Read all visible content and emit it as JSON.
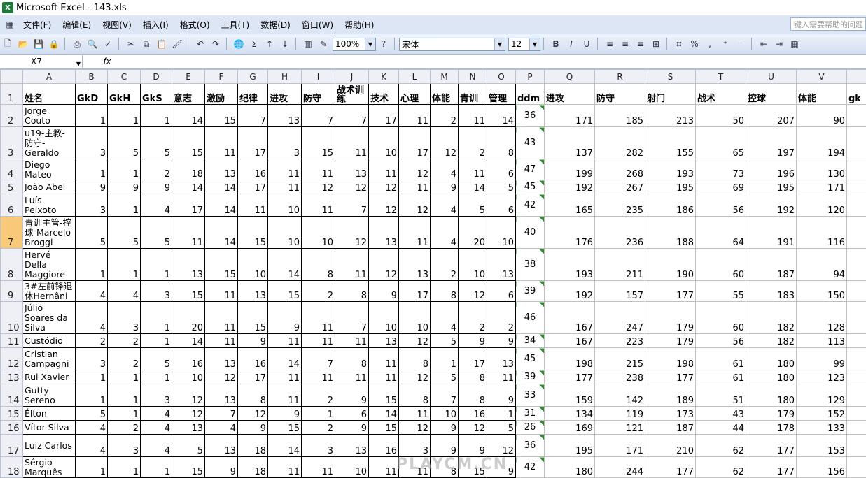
{
  "window": {
    "title": "Microsoft Excel - 143.xls",
    "logo": "X"
  },
  "menu": [
    "文件(F)",
    "编辑(E)",
    "视图(V)",
    "插入(I)",
    "格式(O)",
    "工具(T)",
    "数据(D)",
    "窗口(W)",
    "帮助(H)"
  ],
  "help_placeholder": "键入需要帮助的问题",
  "toolbar": {
    "zoom": "100%",
    "font": "宋体",
    "size": "12",
    "bold": "B",
    "italic": "I",
    "underline": "U"
  },
  "namebox": "X7",
  "fx": "fx",
  "columns": [
    "A",
    "B",
    "C",
    "D",
    "E",
    "F",
    "G",
    "H",
    "I",
    "J",
    "K",
    "L",
    "M",
    "N",
    "O",
    "P",
    "Q",
    "R",
    "S",
    "T",
    "U",
    "V"
  ],
  "headers": [
    "姓名",
    "GkD",
    "GkH",
    "GkS",
    "意志",
    "激励",
    "纪律",
    "进攻",
    "防守",
    "战术训练",
    "技术",
    "心理",
    "体能",
    "青训",
    "管理",
    "ddm",
    "进攻",
    "防守",
    "射门",
    "战术",
    "控球",
    "体能",
    "gk"
  ],
  "rows": [
    {
      "num": "1"
    },
    {
      "num": "2",
      "cells": [
        "Jorge Couto",
        "1",
        "1",
        "1",
        "14",
        "15",
        "7",
        "13",
        "7",
        "7",
        "17",
        "11",
        "2",
        "11",
        "14",
        "36",
        "171",
        "185",
        "213",
        "50",
        "207",
        "90"
      ]
    },
    {
      "num": "3",
      "cells": [
        "u19-主教-防守-Geraldo",
        "3",
        "5",
        "5",
        "15",
        "11",
        "17",
        "3",
        "15",
        "11",
        "10",
        "17",
        "12",
        "2",
        "8",
        "43",
        "137",
        "282",
        "155",
        "65",
        "197",
        "194"
      ]
    },
    {
      "num": "4",
      "cells": [
        "Diego Mateo",
        "1",
        "1",
        "2",
        "18",
        "13",
        "16",
        "11",
        "11",
        "13",
        "11",
        "12",
        "4",
        "11",
        "6",
        "47",
        "199",
        "268",
        "193",
        "73",
        "196",
        "130"
      ]
    },
    {
      "num": "5",
      "cells": [
        "João Abel",
        "9",
        "9",
        "9",
        "14",
        "14",
        "17",
        "11",
        "12",
        "12",
        "12",
        "11",
        "9",
        "14",
        "5",
        "45",
        "192",
        "267",
        "195",
        "69",
        "195",
        "171"
      ]
    },
    {
      "num": "6",
      "cells": [
        "Luís Peixoto",
        "3",
        "1",
        "4",
        "17",
        "14",
        "11",
        "10",
        "11",
        "7",
        "12",
        "12",
        "4",
        "5",
        "6",
        "42",
        "165",
        "235",
        "186",
        "56",
        "192",
        "120"
      ]
    },
    {
      "num": "7",
      "cells": [
        "青训主管-控球-Marcelo Broggi",
        "5",
        "5",
        "5",
        "11",
        "14",
        "15",
        "10",
        "10",
        "12",
        "13",
        "11",
        "4",
        "20",
        "10",
        "40",
        "176",
        "236",
        "188",
        "64",
        "191",
        "116"
      ]
    },
    {
      "num": "8",
      "cells": [
        "Hervé Della Maggiore",
        "1",
        "1",
        "1",
        "13",
        "15",
        "10",
        "14",
        "8",
        "11",
        "12",
        "13",
        "2",
        "10",
        "13",
        "38",
        "193",
        "211",
        "190",
        "60",
        "187",
        "94"
      ]
    },
    {
      "num": "9",
      "cells": [
        "3#左前锋退休Hernâni",
        "4",
        "4",
        "3",
        "15",
        "11",
        "13",
        "15",
        "2",
        "8",
        "9",
        "17",
        "8",
        "12",
        "6",
        "39",
        "192",
        "157",
        "177",
        "55",
        "183",
        "150"
      ]
    },
    {
      "num": "10",
      "cells": [
        "Júlio Soares da Silva",
        "4",
        "3",
        "1",
        "20",
        "11",
        "15",
        "9",
        "11",
        "7",
        "10",
        "10",
        "4",
        "2",
        "2",
        "46",
        "167",
        "247",
        "179",
        "60",
        "182",
        "128"
      ]
    },
    {
      "num": "11",
      "cells": [
        "Custódio",
        "2",
        "2",
        "1",
        "14",
        "11",
        "9",
        "11",
        "11",
        "11",
        "13",
        "12",
        "5",
        "9",
        "9",
        "34",
        "167",
        "223",
        "179",
        "56",
        "182",
        "113"
      ]
    },
    {
      "num": "12",
      "cells": [
        "Cristian Campagni",
        "3",
        "2",
        "5",
        "16",
        "13",
        "16",
        "14",
        "7",
        "8",
        "11",
        "8",
        "1",
        "17",
        "13",
        "45",
        "198",
        "215",
        "198",
        "61",
        "180",
        "99"
      ]
    },
    {
      "num": "13",
      "cells": [
        "Rui Xavier",
        "1",
        "1",
        "1",
        "10",
        "12",
        "17",
        "11",
        "11",
        "11",
        "11",
        "12",
        "5",
        "8",
        "11",
        "39",
        "177",
        "238",
        "177",
        "61",
        "180",
        "123"
      ]
    },
    {
      "num": "14",
      "cells": [
        "Gutty Sereno",
        "1",
        "1",
        "3",
        "12",
        "13",
        "8",
        "11",
        "2",
        "9",
        "15",
        "8",
        "7",
        "8",
        "9",
        "33",
        "159",
        "142",
        "189",
        "51",
        "180",
        "129"
      ]
    },
    {
      "num": "15",
      "cells": [
        "Élton",
        "5",
        "1",
        "4",
        "12",
        "7",
        "12",
        "9",
        "1",
        "6",
        "14",
        "11",
        "10",
        "16",
        "1",
        "31",
        "134",
        "119",
        "173",
        "43",
        "179",
        "152"
      ]
    },
    {
      "num": "16",
      "cells": [
        "Vítor Silva",
        "4",
        "2",
        "4",
        "13",
        "4",
        "9",
        "15",
        "2",
        "9",
        "15",
        "12",
        "9",
        "12",
        "5",
        "26",
        "169",
        "121",
        "187",
        "44",
        "178",
        "133"
      ]
    },
    {
      "num": "17",
      "cells": [
        "Luiz Carlos",
        "4",
        "3",
        "4",
        "5",
        "13",
        "18",
        "14",
        "3",
        "13",
        "16",
        "3",
        "9",
        "9",
        "12",
        "36",
        "195",
        "171",
        "210",
        "62",
        "177",
        "153"
      ]
    },
    {
      "num": "18",
      "cells": [
        "Sérgio Marquês",
        "1",
        "1",
        "1",
        "15",
        "9",
        "18",
        "11",
        "11",
        "10",
        "11",
        "11",
        "8",
        "15",
        "9",
        "42",
        "180",
        "244",
        "177",
        "62",
        "177",
        "156"
      ]
    }
  ],
  "watermark": "PLAYCM.CN"
}
